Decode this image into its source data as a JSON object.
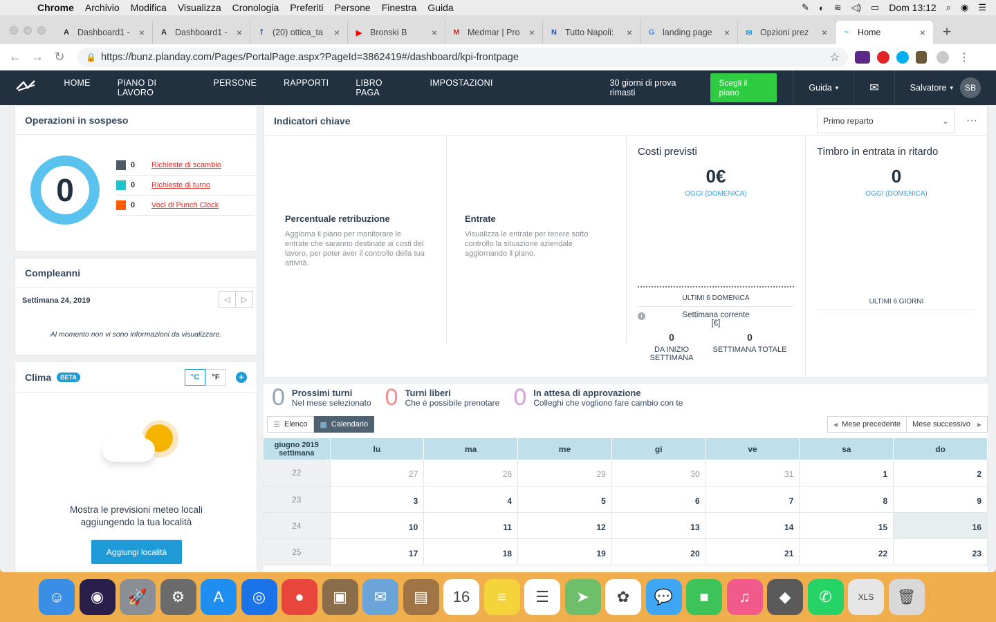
{
  "menubar": {
    "apple": "",
    "items": [
      "Chrome",
      "Archivio",
      "Modifica",
      "Visualizza",
      "Cronologia",
      "Preferiti",
      "Persone",
      "Finestra",
      "Guida"
    ],
    "clock": "Dom 13:12"
  },
  "tabs": [
    {
      "title": "Dashboard1 -",
      "icon": "A",
      "color": "#222"
    },
    {
      "title": "Dashboard1 -",
      "icon": "A",
      "color": "#222"
    },
    {
      "title": "(20) ottica_ta",
      "icon": "f",
      "color": "#3b5998"
    },
    {
      "title": "Bronski B",
      "icon": "▶",
      "color": "#ff0000"
    },
    {
      "title": "Medmar | Pro",
      "icon": "M",
      "color": "#c0392b"
    },
    {
      "title": "Tutto Napoli:",
      "icon": "N",
      "color": "#2155c9"
    },
    {
      "title": "landing page",
      "icon": "G",
      "color": "#4285f4"
    },
    {
      "title": "Opzioni prez",
      "icon": "✉",
      "color": "#1e9bd7"
    },
    {
      "title": "Home",
      "icon": "~",
      "color": "#2aa4c9",
      "active": true
    }
  ],
  "toolbar": {
    "url": "https://bunz.planday.com/Pages/PortalPage.aspx?PageId=3862419#/dashboard/kpi-frontpage"
  },
  "appnav": {
    "nav": [
      "HOME",
      "PIANO DI LAVORO",
      "PERSONE",
      "RAPPORTI",
      "LIBRO PAGA",
      "IMPOSTAZIONI"
    ],
    "trial": "30 giorni di prova rimasti",
    "plan_button": "Scegli il piano",
    "help": "Guida",
    "user": "Salvatore",
    "initials": "SB"
  },
  "pending": {
    "title": "Operazioni in sospeso",
    "total": "0",
    "items": [
      {
        "count": "0",
        "label": "Richieste di scambio",
        "color": "#4a5a66"
      },
      {
        "count": "0",
        "label": "Richieste di turno",
        "color": "#1fc3cd"
      },
      {
        "count": "0",
        "label": "Voci di Punch Clock",
        "color": "#ff5a00"
      }
    ]
  },
  "birthdays": {
    "title": "Compleanni",
    "week": "Settimana 24, 2019",
    "empty": "Al momento non vi sono informazioni da visualizzare."
  },
  "weather": {
    "title": "Clima",
    "badge": "BETA",
    "unit_c": "°C",
    "unit_f": "°F",
    "text": "Mostra le previsioni meteo locali aggiungendo la tua località",
    "button": "Aggiungi località"
  },
  "kpi": {
    "title": "Indicatori chiave",
    "dept": "Primo reparto",
    "wage": {
      "title": "Percentuale retribuzione",
      "desc": "Aggiorna il piano per monitorare le entrate che saranno destinate ai costi del lavoro, per poter aver il controllo della tua attività."
    },
    "revenue": {
      "title": "Entrate",
      "desc": "Visualizza le entrate per tenere sotto controllo la situazione aziendale aggiornando il piano."
    },
    "costs": {
      "title": "Costi previsti",
      "value": "0€",
      "today": "OGGI (DOMENICA)",
      "last": "ULTIMI 6 DOMENICA",
      "week": "Settimana corrente",
      "unit": "[€]",
      "v1": "0",
      "l1": "DA INIZIO SETTIMANA",
      "v2": "0",
      "l2": "SETTIMANA TOTALE"
    },
    "late": {
      "title": "Timbro in entrata in ritardo",
      "value": "0",
      "today": "OGGI (DOMENICA)",
      "last": "ULTIMI 6 GIORNI"
    }
  },
  "shifts": {
    "stats": [
      {
        "n": "0",
        "title": "Prossimi turni",
        "sub": "Nel mese selezionato",
        "color": "#8fa3b5"
      },
      {
        "n": "0",
        "title": "Turni liberi",
        "sub": "Che è possibile prenotare",
        "color": "#f38b8b"
      },
      {
        "n": "0",
        "title": "In attesa di approvazione",
        "sub": "Colleghi che vogliono fare cambio con te",
        "color": "#d79ddc"
      }
    ],
    "list_btn": "Elenco",
    "cal_btn": "Calendario",
    "prev": "Mese precedente",
    "next": "Mese successivo",
    "month": "giugno 2019",
    "week_label": "settimana",
    "days": [
      "lu",
      "ma",
      "me",
      "gi",
      "ve",
      "sa",
      "do"
    ],
    "weeks": [
      {
        "w": "22",
        "d": [
          "27",
          "28",
          "29",
          "30",
          "31",
          "1",
          "2"
        ]
      },
      {
        "w": "23",
        "d": [
          "3",
          "4",
          "5",
          "6",
          "7",
          "8",
          "9"
        ]
      },
      {
        "w": "24",
        "d": [
          "10",
          "11",
          "12",
          "13",
          "14",
          "15",
          "16"
        ]
      },
      {
        "w": "25",
        "d": [
          "17",
          "18",
          "19",
          "20",
          "21",
          "22",
          "23"
        ]
      }
    ]
  },
  "dock": [
    {
      "name": "finder",
      "color": "#3a8ee6",
      "glyph": "☺"
    },
    {
      "name": "siri",
      "color": "#2a1f4a",
      "glyph": "◉"
    },
    {
      "name": "launchpad",
      "color": "#8a8f96",
      "glyph": "🚀"
    },
    {
      "name": "system-preferences",
      "color": "#6b6b6b",
      "glyph": "⚙"
    },
    {
      "name": "app-store",
      "color": "#1f8ef1",
      "glyph": "A"
    },
    {
      "name": "safari",
      "color": "#1a73e8",
      "glyph": "◎"
    },
    {
      "name": "chrome",
      "color": "#e8453c",
      "glyph": "●"
    },
    {
      "name": "preview",
      "color": "#8a6d4a",
      "glyph": "▣"
    },
    {
      "name": "mail",
      "color": "#6ba4d9",
      "glyph": "✉"
    },
    {
      "name": "contacts",
      "color": "#a07444",
      "glyph": "▤"
    },
    {
      "name": "calendar",
      "color": "#ffffff",
      "glyph": "16"
    },
    {
      "name": "notes",
      "color": "#f5d33a",
      "glyph": "≡"
    },
    {
      "name": "reminders",
      "color": "#ffffff",
      "glyph": "☰"
    },
    {
      "name": "maps",
      "color": "#6fbf6a",
      "glyph": "➤"
    },
    {
      "name": "photos",
      "color": "#ffffff",
      "glyph": "✿"
    },
    {
      "name": "messages",
      "color": "#3ea7f5",
      "glyph": "💬"
    },
    {
      "name": "facetime",
      "color": "#3cc35a",
      "glyph": "■"
    },
    {
      "name": "itunes",
      "color": "#f35a8c",
      "glyph": "♫"
    },
    {
      "name": "tableplus",
      "color": "#5a5a5a",
      "glyph": "◆"
    },
    {
      "name": "whatsapp",
      "color": "#25d366",
      "glyph": "✆"
    },
    {
      "name": "xls-file",
      "color": "#e6e6e6",
      "glyph": "XLS"
    },
    {
      "name": "trash",
      "color": "#d9d9d9",
      "glyph": "🗑"
    }
  ],
  "colors": {
    "nav": "#22313f",
    "accent": "#1e9bd7",
    "green": "#2ecc40",
    "donut": "#59c2ee"
  }
}
